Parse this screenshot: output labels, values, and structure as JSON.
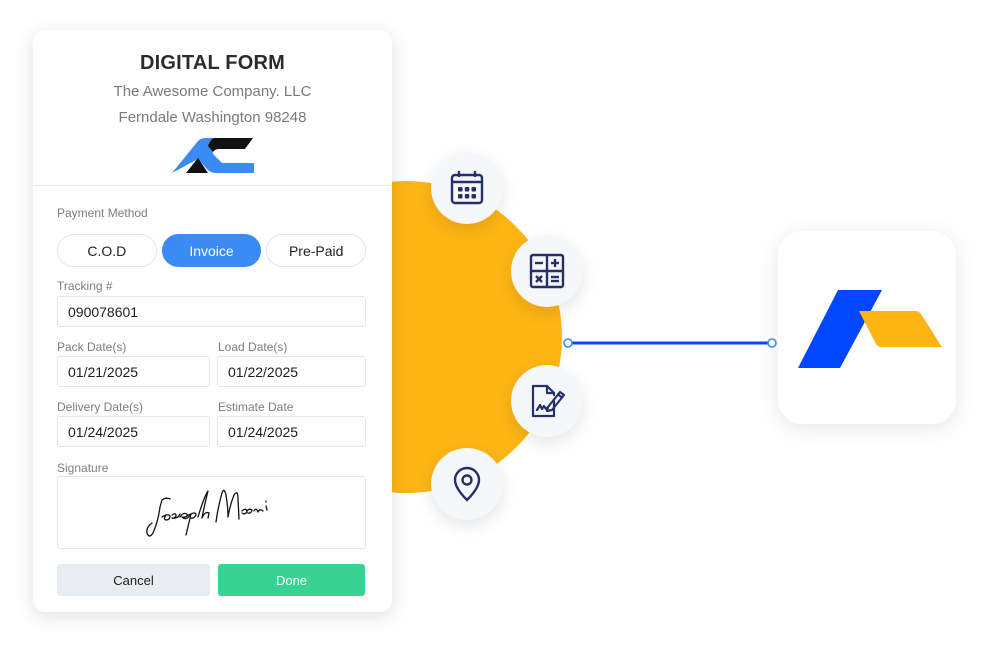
{
  "form": {
    "title": "DIGITAL FORM",
    "company_name": "The Awesome Company. LLC",
    "company_address": "Ferndale Washington 98248",
    "logo": "ac-logo",
    "payment_method": {
      "label": "Payment Method",
      "options": [
        "C.O.D",
        "Invoice",
        "Pre-Paid"
      ],
      "selected": "Invoice"
    },
    "tracking": {
      "label": "Tracking #",
      "value": "090078601"
    },
    "pack_date": {
      "label": "Pack Date(s)",
      "value": "01/21/2025"
    },
    "load_date": {
      "label": "Load Date(s)",
      "value": "01/22/2025"
    },
    "delivery_date": {
      "label": "Delivery Date(s)",
      "value": "01/24/2025"
    },
    "estimate_date": {
      "label": "Estimate Date",
      "value": "01/24/2025"
    },
    "signature": {
      "label": "Signature",
      "value": "Joseph Maani"
    },
    "buttons": {
      "cancel": "Cancel",
      "done": "Done"
    }
  },
  "features": [
    {
      "icon": "calendar-icon"
    },
    {
      "icon": "calculator-icon"
    },
    {
      "icon": "signed-document-icon"
    },
    {
      "icon": "location-pin-icon"
    }
  ],
  "colors": {
    "accent_blue": "#3B8BF4",
    "done_green": "#38D293",
    "sun_yellow": "#FDB515",
    "connector_blue": "#0A49F0",
    "icon_navy": "#24306B",
    "brand_blue": "#0047FF",
    "brand_yellow": "#FDB515"
  },
  "app_tile": {
    "logo": "brand-logo"
  }
}
